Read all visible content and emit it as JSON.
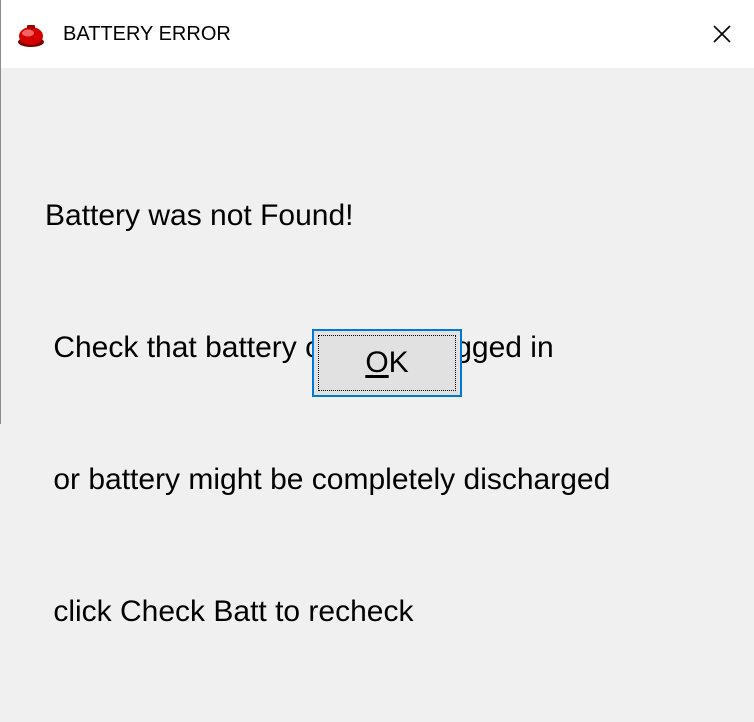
{
  "window": {
    "title": "BATTERY ERROR",
    "close_glyph": "×",
    "icon": "red-battery-icon"
  },
  "message": {
    "lines": [
      "Battery was not Found!",
      " Check that battery cable is plugged in",
      " or battery might be completely discharged",
      " click Check Batt to recheck"
    ]
  },
  "buttons": {
    "ok_mnemonic": "O",
    "ok_rest": "K"
  },
  "colors": {
    "focus_border": "#0078d7",
    "icon_red": "#d40000",
    "background": "#f0f0f0"
  }
}
